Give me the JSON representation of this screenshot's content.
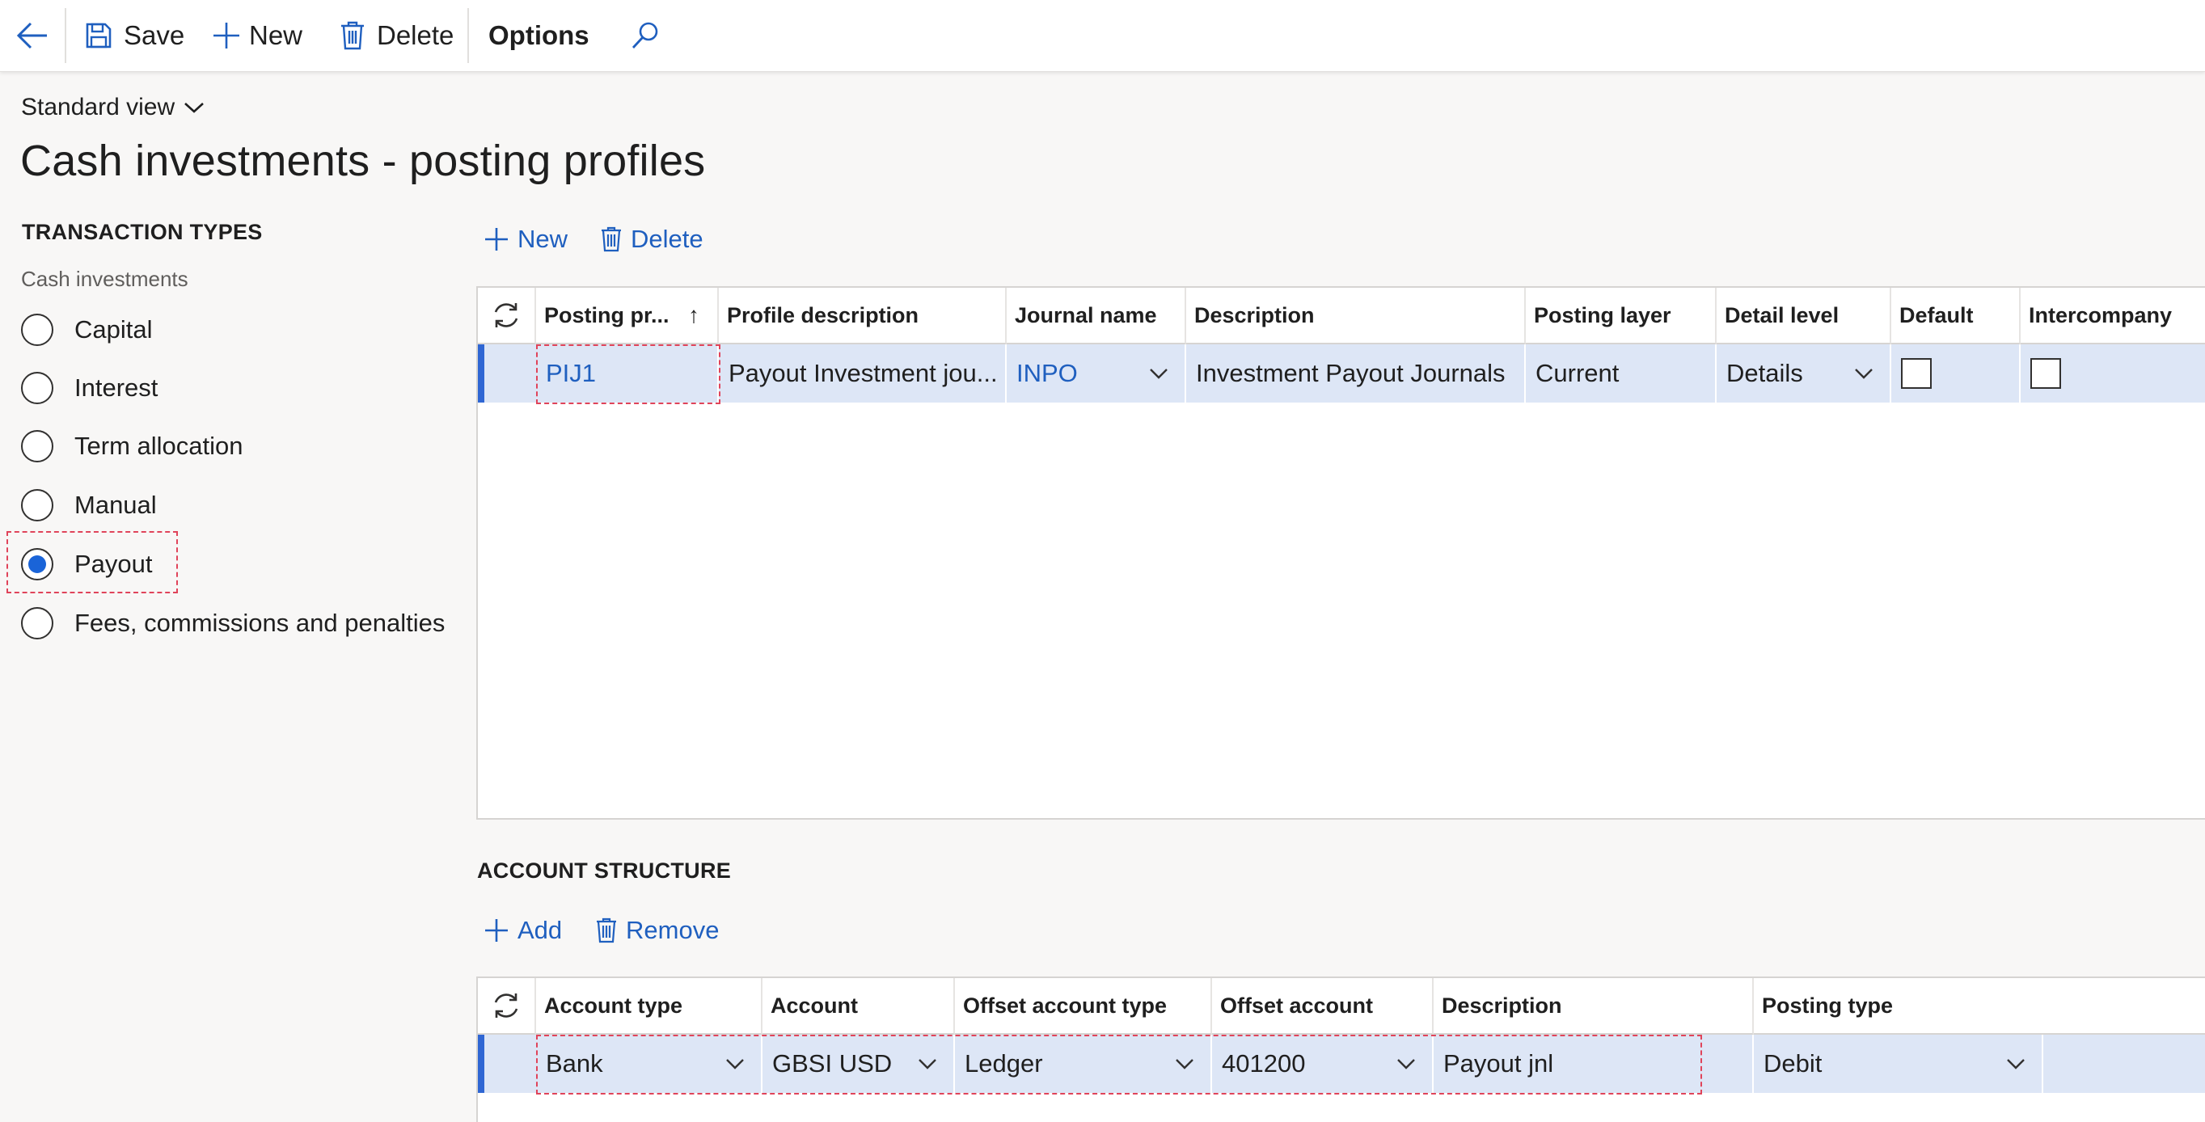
{
  "toolbar": {
    "save_label": "Save",
    "new_label": "New",
    "delete_label": "Delete",
    "options_label": "Options"
  },
  "view": {
    "selector_label": "Standard view"
  },
  "page": {
    "title": "Cash investments - posting profiles"
  },
  "transaction_types": {
    "title": "TRANSACTION TYPES",
    "group_label": "Cash investments",
    "options": [
      {
        "label": "Capital",
        "selected": false
      },
      {
        "label": "Interest",
        "selected": false
      },
      {
        "label": "Term allocation",
        "selected": false
      },
      {
        "label": "Manual",
        "selected": false
      },
      {
        "label": "Payout",
        "selected": true
      },
      {
        "label": "Fees, commissions and penalties",
        "selected": false
      }
    ]
  },
  "profiles_grid": {
    "actions": {
      "new_label": "New",
      "delete_label": "Delete"
    },
    "columns": [
      "Posting pr...",
      "Profile description",
      "Journal name",
      "Description",
      "Posting layer",
      "Detail level",
      "Default",
      "Intercompany"
    ],
    "sort_indicator": "↑",
    "rows": [
      {
        "posting_profile": "PIJ1",
        "profile_description": "Payout Investment jou...",
        "journal_name": "INPO",
        "description": "Investment Payout Journals",
        "posting_layer": "Current",
        "detail_level": "Details",
        "default": false,
        "intercompany": false
      }
    ]
  },
  "account_structure": {
    "title": "ACCOUNT STRUCTURE",
    "actions": {
      "add_label": "Add",
      "remove_label": "Remove"
    },
    "columns": [
      "Account type",
      "Account",
      "Offset account type",
      "Offset account",
      "Description",
      "Posting type"
    ],
    "rows": [
      {
        "account_type": "Bank",
        "account": "GBSI USD",
        "offset_account_type": "Ledger",
        "offset_account": "401200",
        "description": "Payout jnl",
        "posting_type": "Debit"
      }
    ]
  },
  "colors": {
    "accent": "#1f5fbf",
    "selected_row": "#dde6f6",
    "highlight": "#e0445a"
  }
}
